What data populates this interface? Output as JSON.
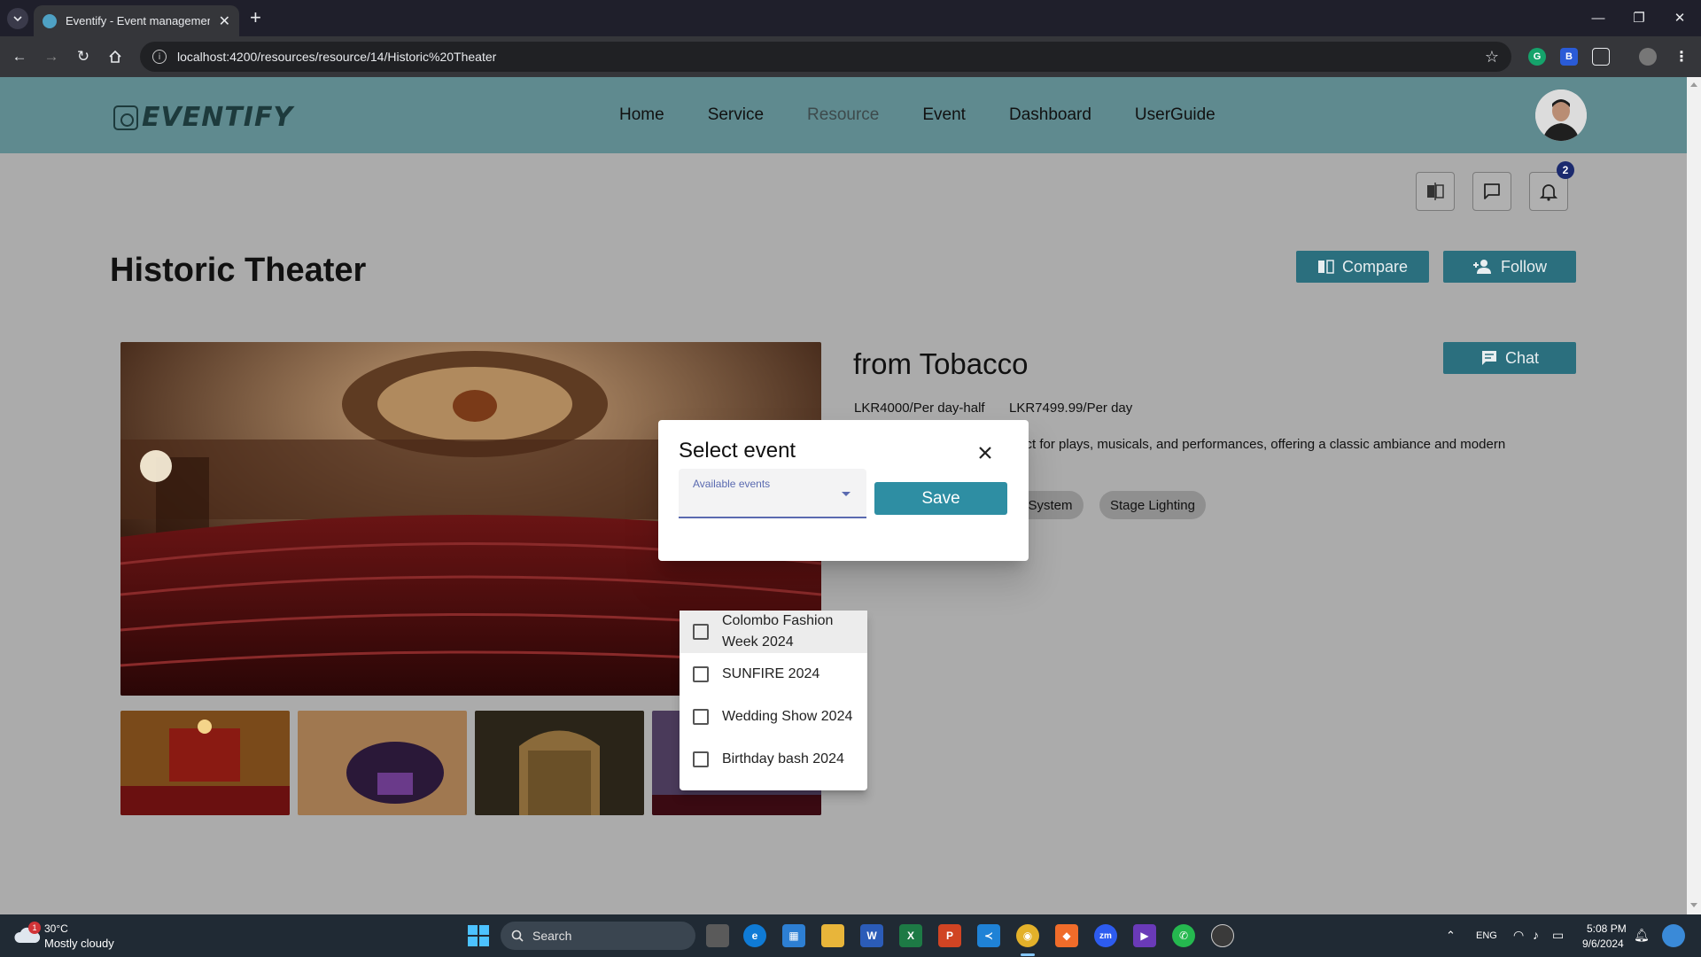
{
  "browser": {
    "tab_title": "Eventify - Event management s",
    "url": "localhost:4200/resources/resource/14/Historic%20Theater"
  },
  "header": {
    "logo_text": "EVENTIFY",
    "nav": [
      "Home",
      "Service",
      "Resource",
      "Event",
      "Dashboard",
      "UserGuide"
    ],
    "active_nav": "Resource"
  },
  "notifications": {
    "count": "2"
  },
  "resource": {
    "title": "Historic Theater",
    "compare_label": "Compare",
    "follow_label": "Follow",
    "chat_label": "Chat",
    "name": "from Tobacco",
    "prices": [
      "LKR4000/Per day-half",
      "LKR7499.99/Per day"
    ],
    "description_visible": "fect for plays, musicals, and performances, offering a classic ambiance and modern",
    "features_visible": [
      "d System",
      "Stage Lighting"
    ]
  },
  "dialog": {
    "title": "Select event",
    "select_label": "Available events",
    "save_label": "Save",
    "options": [
      {
        "label": "Colombo Fashion Week 2024",
        "checked": false
      },
      {
        "label": "SUNFIRE 2024",
        "checked": false
      },
      {
        "label": "Wedding Show 2024",
        "checked": false
      },
      {
        "label": "Birthday bash 2024",
        "checked": false
      }
    ]
  },
  "taskbar": {
    "weather_temp": "30°C",
    "weather_desc": "Mostly cloudy",
    "weather_badge": "1",
    "search_label": "Search",
    "language": "ENG",
    "time": "5:08 PM",
    "date": "9/6/2024"
  },
  "colors": {
    "header": "#5f8a8f",
    "accent": "#2b6f7e",
    "save": "#2e8ea3"
  },
  "icons": [
    "arrow-back-icon",
    "arrow-forward-icon",
    "reload-icon",
    "home-icon",
    "star-icon",
    "close-icon",
    "compare-icon",
    "chat-icon",
    "bell-icon",
    "user-plus-icon",
    "search-icon"
  ]
}
